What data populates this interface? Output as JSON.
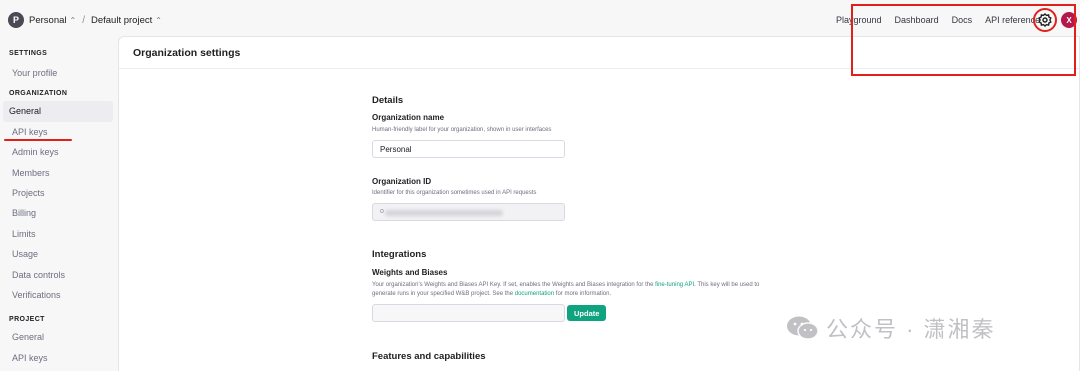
{
  "topbar": {
    "org_initial": "P",
    "org_name": "Personal",
    "separator": "/",
    "project_name": "Default project",
    "chevron": "⌃",
    "nav": [
      "Playground",
      "Dashboard",
      "Docs",
      "API reference"
    ],
    "user_initial": "X",
    "icons": [
      "settings-gear-icon",
      "chevron-updown-icon"
    ]
  },
  "sidebar": {
    "settings_heading": "SETTINGS",
    "your_profile": "Your profile",
    "organization_heading": "ORGANIZATION",
    "org_items": [
      "General",
      "API keys",
      "Admin keys",
      "Members",
      "Projects",
      "Billing",
      "Limits",
      "Usage",
      "Data controls",
      "Verifications"
    ],
    "active_item": "General",
    "project_heading": "PROJECT",
    "project_items": [
      "General",
      "API keys"
    ]
  },
  "main": {
    "title": "Organization settings",
    "details": {
      "heading": "Details",
      "org_name_label": "Organization name",
      "org_name_hint": "Human-friendly label for your organization, shown in user interfaces",
      "org_name_value": "Personal",
      "org_id_label": "Organization ID",
      "org_id_hint": "Identifier for this organization sometimes used in API requests",
      "org_id_prefix": "o"
    },
    "integrations": {
      "heading": "Integrations",
      "wandb_label": "Weights and Biases",
      "hint_part1": "Your organization's Weights and Biases API Key. If set, enables the Weights and Biases integration for the ",
      "hint_link1": "fine-tuning API",
      "hint_part2": ". This key will be used to",
      "hint_part3": "generate runs in your specified W&B project. See the ",
      "hint_link2": "documentation",
      "hint_part4": " for more information.",
      "update_label": "Update"
    },
    "features": {
      "heading": "Features and capabilities"
    }
  },
  "watermark": {
    "text": "公众号 · 潇湘秦",
    "icon": "wechat-icon"
  },
  "colors": {
    "accent": "#10a37f",
    "annotation": "#e0201b",
    "user_avatar": "#b4184a"
  }
}
